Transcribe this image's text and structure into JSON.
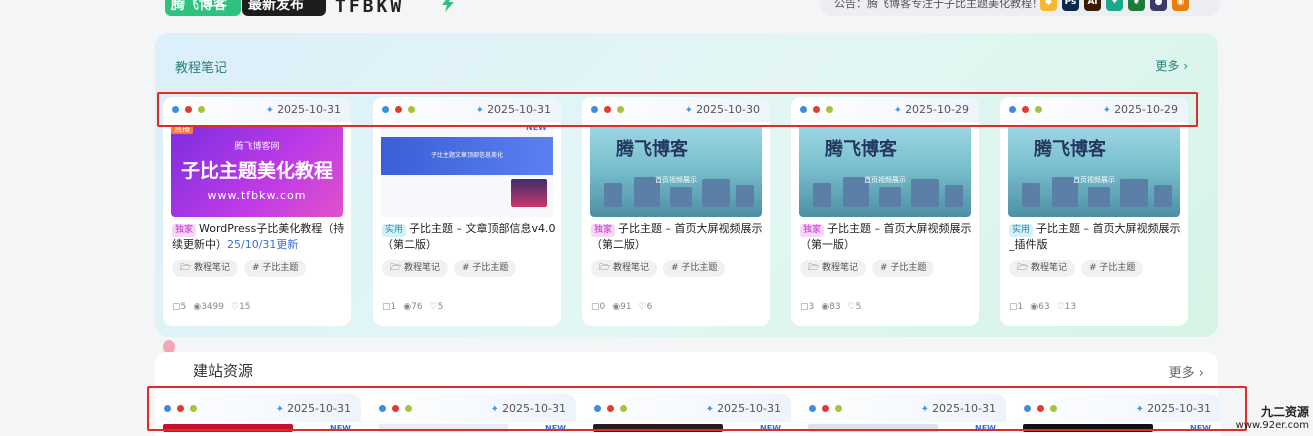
{
  "header": {
    "tag1_a": "腾",
    "tag1_b": "飞",
    "tag1_c": "博客",
    "tag2": "最新发布",
    "logo": "TFBKW",
    "notice": "公告：腾飞博客专注于子比主题美化教程！",
    "app_icons": [
      {
        "name": "diamond-icon",
        "label": "◆",
        "color": "#f5b82e"
      },
      {
        "name": "photoshop-icon",
        "label": "Ps",
        "color": "#0b2a4a"
      },
      {
        "name": "illustrator-icon",
        "label": "Ai",
        "color": "#3a1a00"
      },
      {
        "name": "bird-icon",
        "label": "✦",
        "color": "#1aa88a"
      },
      {
        "name": "leaf-icon",
        "label": "❦",
        "color": "#1f7a3a"
      },
      {
        "name": "sphere-icon",
        "label": "●",
        "color": "#3a3a6a"
      },
      {
        "name": "blender-icon",
        "label": "◉",
        "color": "#e87d0d"
      }
    ]
  },
  "section1": {
    "title": "教程笔记",
    "more": "更多 ›",
    "cards": [
      {
        "date": "2025-10-31",
        "badge": "独家",
        "badge_type": "ex",
        "title": "WordPress子比美化教程（持续更新中）",
        "update": "25/10/31更新",
        "thumb_type": "purple",
        "thumb_small": "腾飞博客网",
        "thumb_big": "子比主题美化教程",
        "thumb_url": "www.tfbkw.com",
        "thumb_tag": "直播",
        "chips": [
          "🗁 教程笔记",
          "# 子比主题"
        ],
        "stats": {
          "comments": "5",
          "views": "3499",
          "likes": "15"
        }
      },
      {
        "date": "2025-10-31",
        "badge": "实用",
        "badge_type": "use",
        "title": "子比主题 – 文章顶部信息v4.0（第二版）",
        "update": "",
        "thumb_type": "doc",
        "thumb_bar": "子比主题文章顶部信息美化",
        "thumb_new": "NEW",
        "chips": [
          "🗁 教程笔记",
          "# 子比主题"
        ],
        "stats": {
          "comments": "1",
          "views": "76",
          "likes": "5"
        }
      },
      {
        "date": "2025-10-30",
        "badge": "独家",
        "badge_type": "ex",
        "title": "子比主题 – 首页大屏视频展示（第二版）",
        "update": "",
        "thumb_type": "city",
        "thumb_big": "腾飞博客",
        "thumb_caption": "首页视频展示",
        "chips": [
          "🗁 教程笔记",
          "# 子比主题"
        ],
        "stats": {
          "comments": "0",
          "views": "91",
          "likes": "6"
        }
      },
      {
        "date": "2025-10-29",
        "badge": "独家",
        "badge_type": "ex",
        "title": "子比主题 – 首页大屏视频展示（第一版）",
        "update": "",
        "thumb_type": "city",
        "thumb_big": "腾飞博客",
        "thumb_caption": "首页视频展示",
        "chips": [
          "🗁 教程笔记",
          "# 子比主题"
        ],
        "stats": {
          "comments": "3",
          "views": "83",
          "likes": "5"
        }
      },
      {
        "date": "2025-10-29",
        "badge": "实用",
        "badge_type": "use",
        "title": "子比主题 – 首页大屏视频展示_插件版",
        "update": "",
        "thumb_type": "city",
        "thumb_big": "腾飞博客",
        "thumb_caption": "首页视频展示",
        "chips": [
          "🗁 教程笔记",
          "# 子比主题"
        ],
        "stats": {
          "comments": "1",
          "views": "63",
          "likes": "13"
        }
      }
    ]
  },
  "section2": {
    "title": "建站资源",
    "more": "更多 ›",
    "cards": [
      {
        "date": "2025-10-31",
        "new": "NEW",
        "strip": "#c8102e"
      },
      {
        "date": "2025-10-31",
        "new": "NEW",
        "strip": "#e8edf5"
      },
      {
        "date": "2025-10-31",
        "new": "NEW",
        "strip": "#2a1a1a"
      },
      {
        "date": "2025-10-31",
        "new": "NEW",
        "strip": "#dde3ec"
      },
      {
        "date": "2025-10-31",
        "new": "NEW",
        "strip": "#111111"
      }
    ]
  },
  "watermark": {
    "line1": "九二资源",
    "line2": "www.92er.com"
  },
  "colors": {
    "accent": "#2a7d79",
    "highlight": "#e02b2b",
    "exclusive": "#c233c9",
    "practical": "#1c92b4"
  }
}
